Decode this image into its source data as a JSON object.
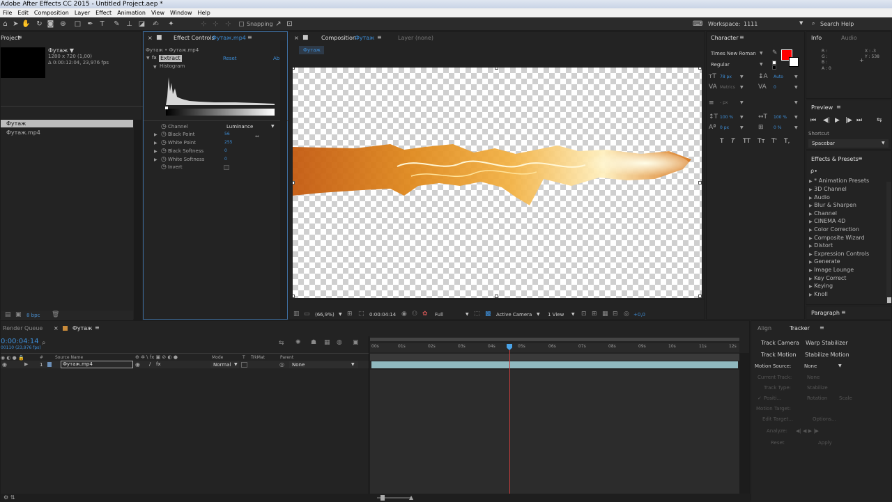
{
  "window": {
    "title": "Adobe After Effects CC 2015 - Untitled Project.aep *"
  },
  "menu": [
    "File",
    "Edit",
    "Composition",
    "Layer",
    "Effect",
    "Animation",
    "View",
    "Window",
    "Help"
  ],
  "toolbar": {
    "snapping": "Snapping",
    "workspace_label": "Workspace:",
    "workspace_value": "1111",
    "search_help": "Search Help"
  },
  "project": {
    "tab": "Project",
    "item_name": "Футаж ▼",
    "item_info1": "1280 x 720 (1,00)",
    "item_info2": "Δ 0:00:12:04, 23,976 fps",
    "items": [
      "Футаж",
      "Футаж.mp4"
    ],
    "bpc": "8 bpc"
  },
  "effect_controls": {
    "tab": "Effect Controls",
    "tab_target": "Футаж.mp4",
    "breadcrumb": "Футаж • Футаж.mp4",
    "effect_name": "Extract",
    "reset": "Reset",
    "about": "Ab",
    "histogram": "Histogram",
    "params": [
      {
        "label": "Channel",
        "value": "Luminance"
      },
      {
        "label": "Black Point",
        "value": "56"
      },
      {
        "label": "White Point",
        "value": "255"
      },
      {
        "label": "Black Softness",
        "value": "0"
      },
      {
        "label": "White Softness",
        "value": "0"
      },
      {
        "label": "Invert",
        "value": ""
      }
    ]
  },
  "composition": {
    "tab": "Composition",
    "tab_target": "Футаж",
    "layer_tab": "Layer (none)",
    "comp_chip": "Футаж",
    "footer": {
      "zoom": "(66,9%)",
      "timecode": "0:00:04:14",
      "resolution": "Full",
      "camera": "Active Camera",
      "views": "1 View",
      "exposure": "+0,0"
    }
  },
  "character": {
    "tab": "Character",
    "font": "Times New Roman",
    "style": "Regular",
    "size": "78 px",
    "leading": "Auto",
    "kerning": "Metrics",
    "tracking": "0",
    "stroke_unit": "- px",
    "vscale": "100 %",
    "hscale": "100 %",
    "baseline": "0 px",
    "tsume": "0 %",
    "styles": [
      "T",
      "T",
      "TT",
      "Tт",
      "T'",
      "T,"
    ]
  },
  "info": {
    "tab": "Info",
    "audio_tab": "Audio",
    "r": "R :",
    "g": "G :",
    "b": "B :",
    "a": "A : 0",
    "x": "X : -3",
    "y": "Y : 538"
  },
  "preview": {
    "tab": "Preview",
    "shortcut_label": "Shortcut",
    "shortcut_value": "Spacebar"
  },
  "effects_presets": {
    "tab": "Effects & Presets",
    "search": "ρ∙",
    "items": [
      "* Animation Presets",
      "3D Channel",
      "Audio",
      "Blur & Sharpen",
      "Channel",
      "CINEMA 4D",
      "Color Correction",
      "Composite Wizard",
      "Distort",
      "Expression Controls",
      "Generate",
      "Image Lounge",
      "Key Correct",
      "Keying",
      "Knoll"
    ]
  },
  "paragraph": {
    "tab": "Paragraph"
  },
  "timeline": {
    "render_queue": "Render Queue",
    "comp_tab": "Футаж",
    "timecode": "0:00:04:14",
    "fps": "00110 (23,976 fps)",
    "headers": {
      "num": "#",
      "source": "Source Name",
      "mode": "Mode",
      "t": "T",
      "trkmat": "TrkMat",
      "parent": "Parent"
    },
    "layer": {
      "num": "1",
      "name": "Футаж.mp4",
      "mode": "Normal",
      "parent": "None"
    },
    "ruler": [
      "00s",
      "01s",
      "02s",
      "03s",
      "04s",
      "05s",
      "06s",
      "07s",
      "08s",
      "09s",
      "10s",
      "11s",
      "12s"
    ]
  },
  "tracker": {
    "align_tab": "Align",
    "tab": "Tracker",
    "track_camera": "Track Camera",
    "warp_stabilizer": "Warp Stabilizer",
    "track_motion": "Track Motion",
    "stabilize_motion": "Stabilize Motion",
    "motion_source_label": "Motion Source:",
    "motion_source_value": "None",
    "current_track_label": "Current Track:",
    "current_track_value": "None",
    "track_type_label": "Track Type:",
    "track_type_value": "Stabilize",
    "position": "Positi...",
    "rotation": "Rotation",
    "scale": "Scale",
    "motion_target": "Motion Target:",
    "edit_target": "Edit Target...",
    "options": "Options...",
    "analyze": "Analyze:",
    "reset": "Reset",
    "apply": "Apply"
  },
  "colors": {
    "accent": "#3d8ed8",
    "fill_color": "#ff0000",
    "playhead": "#c43c3c",
    "layer_bar": "#8fb8be"
  }
}
